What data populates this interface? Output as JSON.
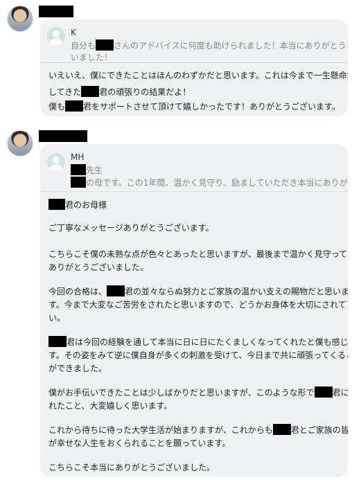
{
  "messages": [
    {
      "quote": {
        "author": "K",
        "lines": [
          {
            "before": "自分も",
            "after": "さんのアドバイスに何度も助けられました！本当にありがとうござ"
          },
          {
            "before": "いました！",
            "after": ""
          }
        ]
      },
      "body": [
        {
          "before": "いえいえ、僕にできたことはほんのわずかだと思います。これは今まで一生懸命勉強",
          "after": ""
        },
        {
          "before": "してきた",
          "after": "君の頑張りの結果だよ！"
        },
        {
          "before": "僕も",
          "after": "君をサポートさせて頂けて嬉しかったです！ありがとうございます。"
        }
      ]
    },
    {
      "quote": {
        "author": "MH",
        "lines": [
          {
            "before": "",
            "after": "先生"
          },
          {
            "before": "",
            "after": "の母です。この1年間、温かく見守り、励ましていただき本当にありが..."
          }
        ]
      },
      "body": [
        {
          "before": "",
          "after": "君のお母様"
        },
        {
          "before": "ご丁寧なメッセージありがとうございます。",
          "after": ""
        },
        {
          "before": "こちらこそ僕の未熟な点が色々とあったと思いますが、最後まで温かく見守って下さり",
          "after": ""
        },
        {
          "before": "ありがとうございました。",
          "after": ""
        },
        {
          "before": "今回の合格は、",
          "after": "君の並々ならぬ努力とご家族の温かい支えの賜物だと思いま"
        },
        {
          "before": "す。今まで大変なご苦労をされたと思いますので、どうかお身体を大切にされて下さ",
          "after": ""
        },
        {
          "before": "い。",
          "after": ""
        },
        {
          "before": "",
          "after": "君は今回の経験を通して本当に日に日にたくましくなってくれたと僕も感じま"
        },
        {
          "before": "す。その姿をみて逆に僕自身が多くの刺激を受けて、今日まで共に頑張ってくること",
          "after": ""
        },
        {
          "before": "ができました。",
          "after": ""
        },
        {
          "before": "僕がお手伝いできたことは少しばかりだと思いますが、このような形で",
          "after": "君に関わ"
        },
        {
          "before": "れたこと、大変嬉しく思います。",
          "after": ""
        },
        {
          "before": "これから待ちに待った大学生活が始まりますが、これからも",
          "after": "君とご家族の皆さん"
        },
        {
          "before": "が幸せな人生をおくられることを願っています。",
          "after": ""
        },
        {
          "before": "こちらこそ本当にありがとうございました。",
          "after": ""
        }
      ]
    }
  ]
}
